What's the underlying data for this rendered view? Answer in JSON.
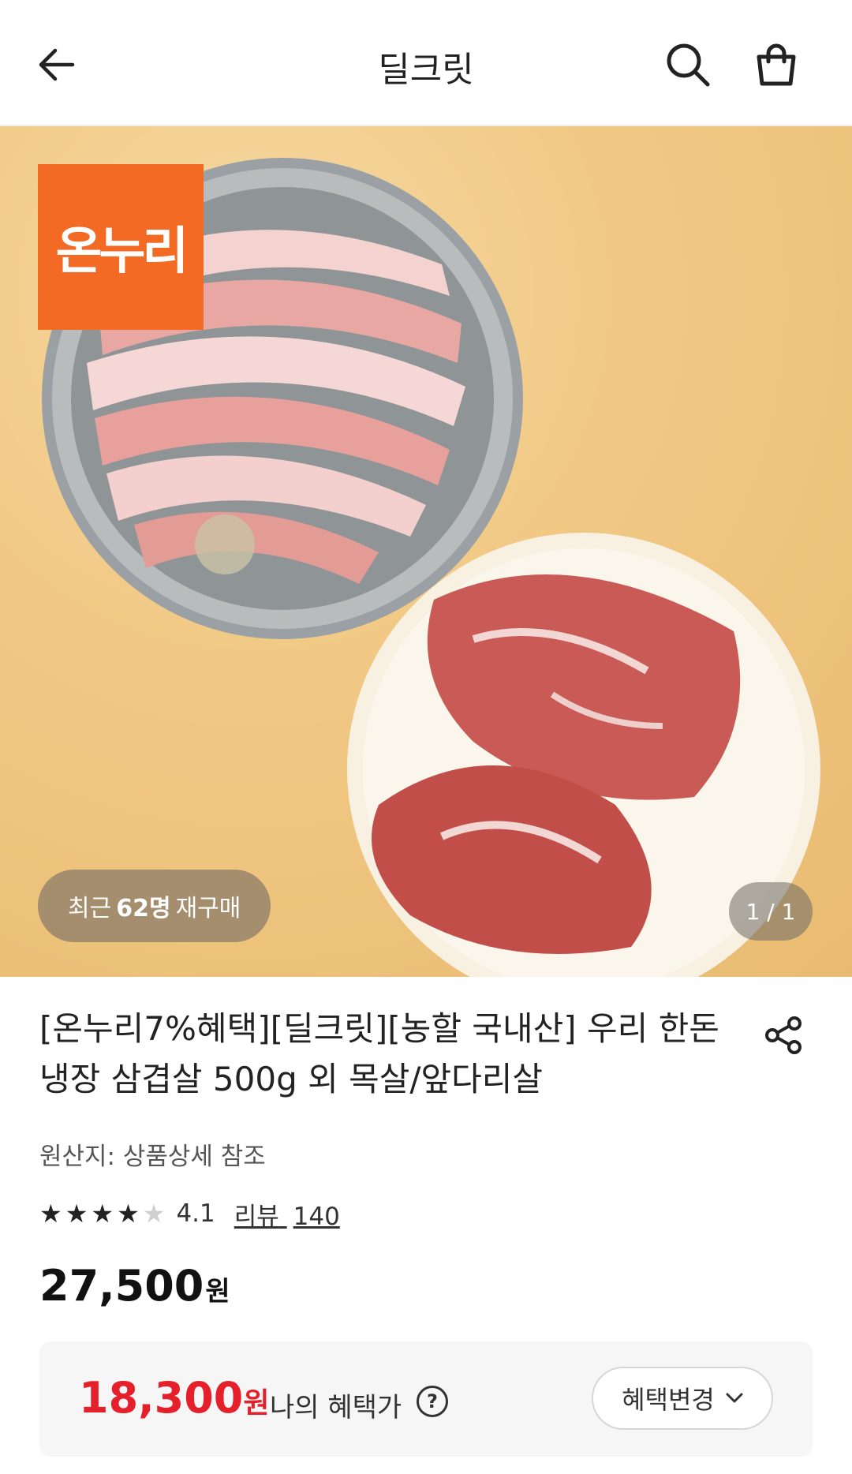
{
  "header": {
    "title": "딜크릿"
  },
  "hero": {
    "badge_text": "온누리",
    "repurchase": {
      "prefix": "최근",
      "count": "62명",
      "suffix": "재구매"
    },
    "pager": "1 / 1"
  },
  "product": {
    "title": "[온누리7%혜택][딜크릿][농할 국내산] 우리 한돈 냉장 삼겹살 500g 외 목살/앞다리살",
    "origin": "원산지: 상품상세 참조",
    "rating": {
      "score": "4.1",
      "stars": 4,
      "max_stars": 5
    },
    "reviews": {
      "label": "리뷰",
      "count": "140"
    },
    "price": {
      "amount": "27,500",
      "unit": "원"
    }
  },
  "benefit": {
    "amount": "18,300",
    "unit": "원",
    "label": "나의 혜택가",
    "help": "?",
    "change_label": "혜택변경"
  },
  "colors": {
    "accent_red": "#e5202a",
    "onnuri_orange": "#f26a24"
  },
  "icons": [
    "back-arrow-icon",
    "search-icon",
    "cart-icon",
    "share-icon",
    "help-icon",
    "chevron-down-icon",
    "star-icon"
  ]
}
